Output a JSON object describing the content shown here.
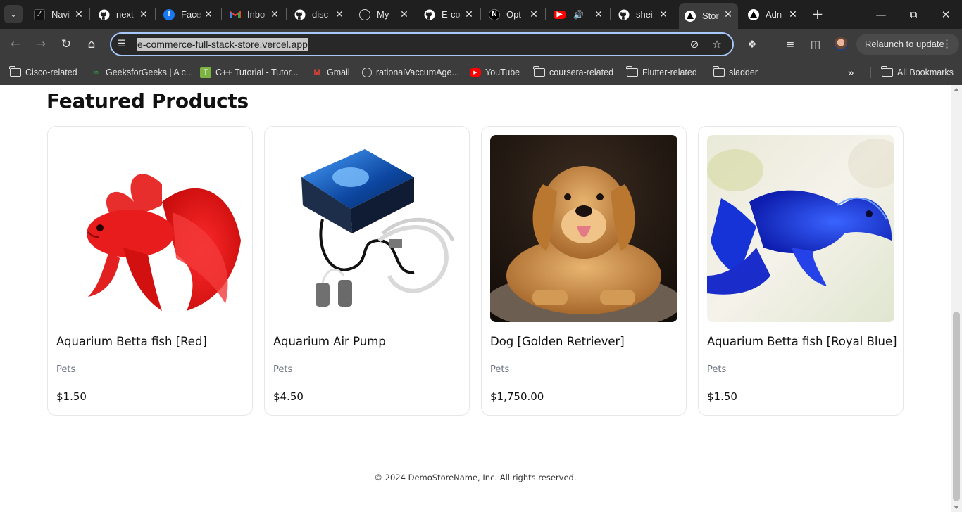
{
  "browser": {
    "tabs": [
      {
        "title": "Navi",
        "icon": "nav-icon",
        "color": "#111111"
      },
      {
        "title": "next",
        "icon": "github-icon",
        "color": "#ffffff"
      },
      {
        "title": "Face",
        "icon": "facebook-icon",
        "color": "#1877f2"
      },
      {
        "title": "Inbo",
        "icon": "gmail-icon",
        "color": "#ea4335"
      },
      {
        "title": "disc",
        "icon": "github-icon",
        "color": "#ffffff"
      },
      {
        "title": "My",
        "icon": "globe-icon",
        "color": "#cfcfcf"
      },
      {
        "title": "E-co",
        "icon": "github-icon",
        "color": "#ffffff"
      },
      {
        "title": "Opt",
        "icon": "nextjs-icon",
        "color": "#000000"
      },
      {
        "title": "",
        "icon": "youtube-icon",
        "color": "#ff0000"
      },
      {
        "title": "shei",
        "icon": "github-icon",
        "color": "#ffffff"
      },
      {
        "title": "Stor",
        "icon": "vercel-icon",
        "color": "#000000",
        "active": true
      },
      {
        "title": "Adn",
        "icon": "vercel-icon",
        "color": "#000000"
      }
    ],
    "url": "e-commerce-full-stack-store.vercel.app",
    "relaunch_label": "Relaunch to update",
    "bookmarks": [
      {
        "label": "Cisco-related",
        "icon": "folder-icon"
      },
      {
        "label": "GeeksforGeeks | A c...",
        "icon": "gfg-icon"
      },
      {
        "label": "C++ Tutorial - Tutor...",
        "icon": "tutorial-icon"
      },
      {
        "label": "Gmail",
        "icon": "gmail-icon"
      },
      {
        "label": "rationalVaccumAge...",
        "icon": "globe-icon"
      },
      {
        "label": "YouTube",
        "icon": "youtube-icon"
      },
      {
        "label": "coursera-related",
        "icon": "folder-icon"
      },
      {
        "label": "Flutter-related",
        "icon": "folder-icon"
      },
      {
        "label": "sladder",
        "icon": "folder-icon"
      }
    ],
    "all_bookmarks_label": "All Bookmarks"
  },
  "page": {
    "heading": "Featured Products",
    "products": [
      {
        "name": "Aquarium Betta fish [Red]",
        "category": "Pets",
        "price": "$1.50",
        "image": "red-betta-fish-image"
      },
      {
        "name": "Aquarium Air Pump",
        "category": "Pets",
        "price": "$4.50",
        "image": "air-pump-image"
      },
      {
        "name": "Dog [Golden Retriever]",
        "category": "Pets",
        "price": "$1,750.00",
        "image": "golden-retriever-image"
      },
      {
        "name": "Aquarium Betta fish [Royal Blue]",
        "category": "Pets",
        "price": "$1.50",
        "image": "blue-betta-fish-image"
      }
    ],
    "footer": "© 2024 DemoStoreName, Inc. All rights reserved."
  },
  "colors": {
    "chrome_dark": "#1f1f1f",
    "toolbar": "#3c3c3c",
    "card_border": "#e5e7eb",
    "category_gray": "#6b7280"
  }
}
